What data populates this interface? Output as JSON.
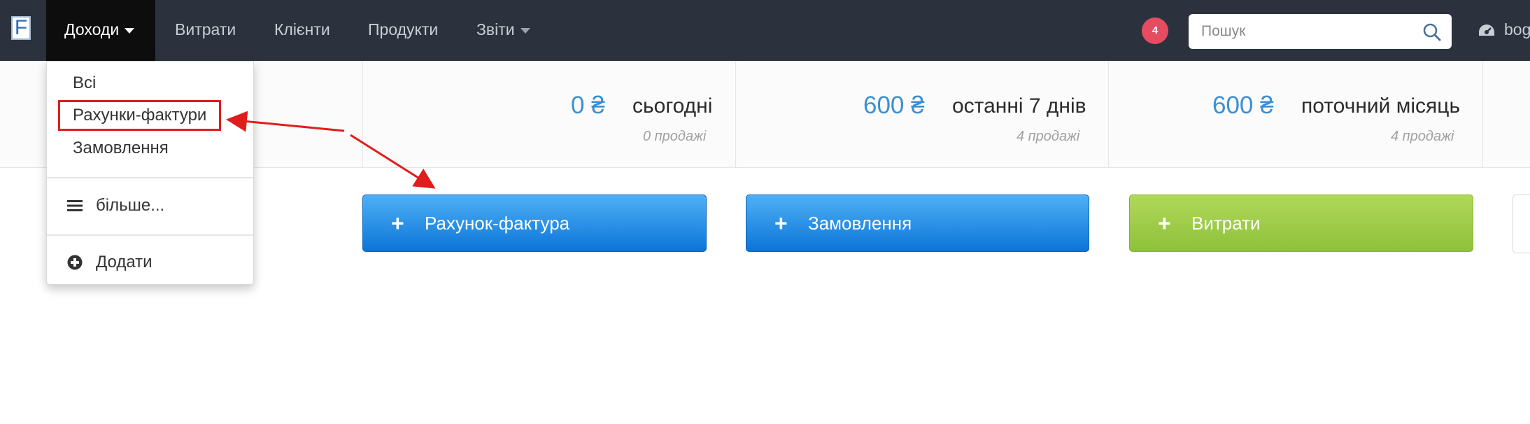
{
  "nav": {
    "logo_letter": "F",
    "items": [
      {
        "label": "Доходи",
        "active": true
      },
      {
        "label": "Витрати"
      },
      {
        "label": "Клієнти"
      },
      {
        "label": "Продукти"
      },
      {
        "label": "Звіти"
      }
    ],
    "notification_count": "4",
    "search_placeholder": "Пошук",
    "user_label": "bogd"
  },
  "dropdown": {
    "items": [
      "Всі",
      "Рахунки-фактури",
      "Замовлення"
    ],
    "more_label": "більше...",
    "add_label": "Додати"
  },
  "stats": [
    {
      "value": "0 ₴",
      "label": "сьогодні",
      "sub": "0 продажі"
    },
    {
      "value": "600 ₴",
      "label": "останні 7 днів",
      "sub": "4 продажі"
    },
    {
      "value": "600 ₴",
      "label": "поточний місяць",
      "sub": "4 продажі"
    }
  ],
  "actions": [
    {
      "label": "Рахунок-фактура",
      "color": "#1a85e6"
    },
    {
      "label": "Замовлення",
      "color": "#1a85e6"
    },
    {
      "label": "Витрати",
      "color": "#9dcc48"
    }
  ],
  "colors": {
    "navbar": "#2b323d",
    "accent_value": "#3d8fd1",
    "badge": "#e64c61",
    "annotation": "#e01d1d"
  }
}
